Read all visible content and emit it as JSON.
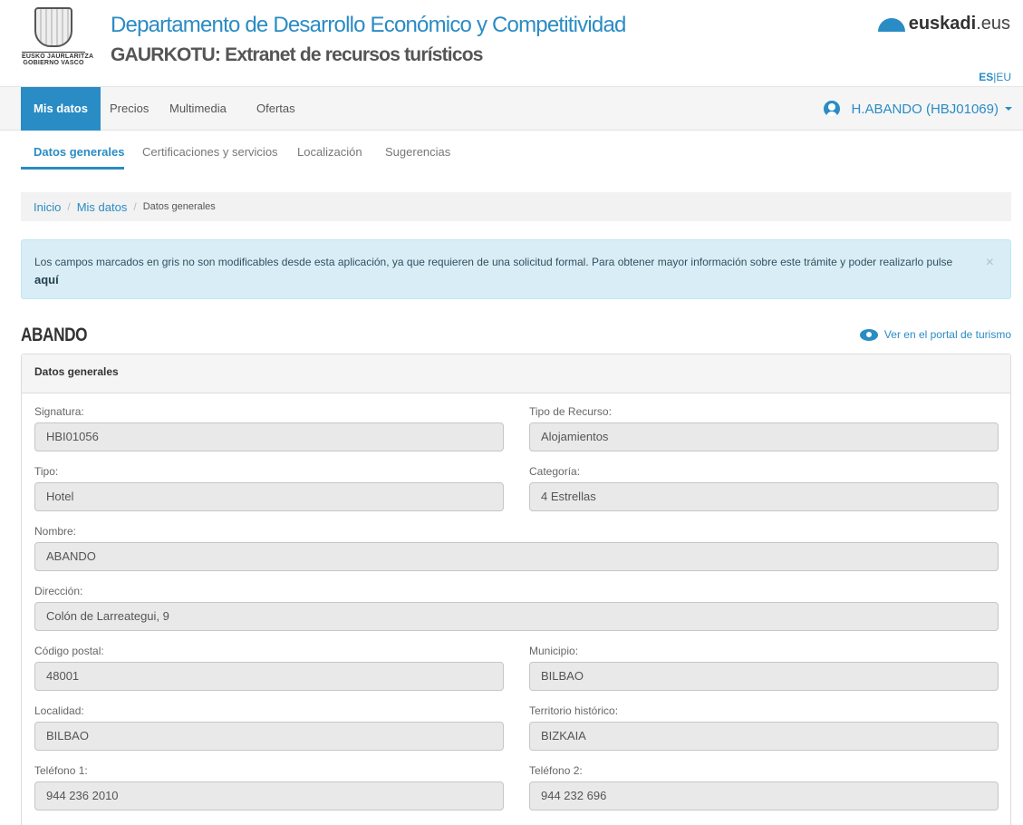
{
  "header": {
    "logo": {
      "line1": "EUSKO JAURLARITZA",
      "line2": "GOBIERNO VASCO"
    },
    "department": "Departamento de Desarrollo Económico y Competitividad",
    "app_title": "GAURKOTU: Extranet de recursos turísticos",
    "euskadi": {
      "bold": "euskadi",
      "suffix": ".eus"
    },
    "lang": {
      "es": "ES",
      "sep": "|",
      "eu": "EU"
    }
  },
  "main_nav": {
    "tabs": [
      "Mis datos",
      "Precios",
      "Multimedia",
      "Ofertas"
    ],
    "user": "H.ABANDO (HBJ01069)"
  },
  "sub_nav": {
    "tabs": [
      "Datos generales",
      "Certificaciones y servicios",
      "Localización",
      "Sugerencias"
    ]
  },
  "breadcrumb": {
    "home": "Inicio",
    "section": "Mis datos",
    "current": "Datos generales",
    "sep": "/"
  },
  "alert": {
    "text": "Los campos marcados en gris no son modificables desde esta aplicación, ya que requieren de una solicitud formal. Para obtener mayor información sobre este trámite y poder realizarlo pulse ",
    "link": "aquí",
    "close": "×"
  },
  "resource": {
    "title": "ABANDO",
    "portal_link": "Ver en el portal de turismo"
  },
  "panel": {
    "title": "Datos generales",
    "fields": {
      "signatura": {
        "label": "Signatura:",
        "value": "HBI01056"
      },
      "tipo_recurso": {
        "label": "Tipo de Recurso:",
        "value": "Alojamientos"
      },
      "tipo": {
        "label": "Tipo:",
        "value": "Hotel"
      },
      "categoria": {
        "label": "Categoría:",
        "value": "4 Estrellas"
      },
      "nombre": {
        "label": "Nombre:",
        "value": "ABANDO"
      },
      "direccion": {
        "label": "Dirección:",
        "value": "Colón de Larreategui, 9"
      },
      "codigo_postal": {
        "label": "Código postal:",
        "value": "48001"
      },
      "municipio": {
        "label": "Municipio:",
        "value": "BILBAO"
      },
      "localidad": {
        "label": "Localidad:",
        "value": "BILBAO"
      },
      "territorio": {
        "label": "Territorio histórico:",
        "value": "BIZKAIA"
      },
      "telefono1": {
        "label": "Teléfono 1:",
        "value": "944 236 2010"
      },
      "telefono2": {
        "label": "Teléfono 2:",
        "value": "944 232 696"
      }
    }
  },
  "colors": {
    "accent": "#2a8cc4",
    "alert_bg": "#d9edf7",
    "readonly_bg": "#e9e9e9"
  }
}
